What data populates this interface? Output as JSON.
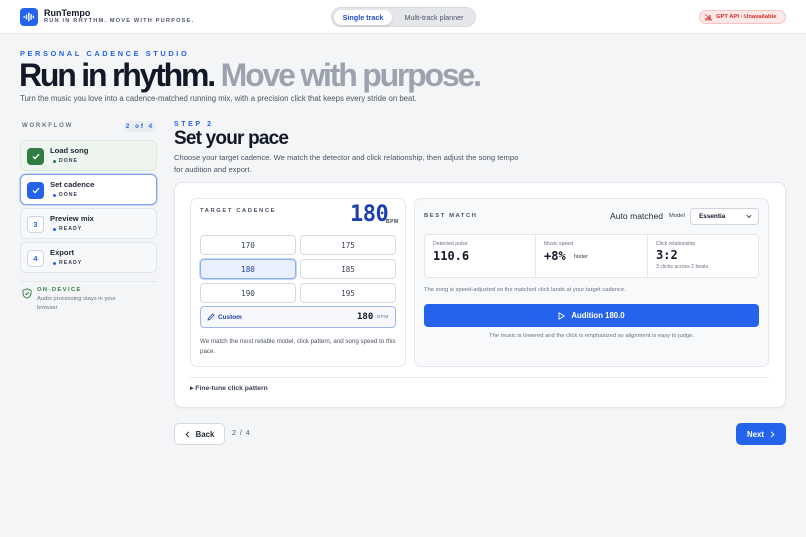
{
  "app": {
    "name": "RunTempo",
    "tagline": "RUN IN RHYTHM. MOVE WITH PURPOSE."
  },
  "modes": [
    {
      "label": "Single track",
      "active": true
    },
    {
      "label": "Multi-track planner",
      "active": false
    }
  ],
  "api_status": "GPT API · Unavailable",
  "hero": {
    "eyebrow": "PERSONAL CADENCE STUDIO",
    "title_dark": "Run in rhythm.",
    "title_muted": "Move with purpose.",
    "subtitle": "Turn the music you love into a cadence-matched running mix, with a precision click that keeps every stride on beat."
  },
  "workflow": {
    "title": "WORKFLOW",
    "count": "2 of 4",
    "steps": [
      {
        "label": "Load song",
        "status": "DONE",
        "icon": "check-icon",
        "num": ""
      },
      {
        "label": "Set cadence",
        "status": "DONE",
        "icon": "check-icon",
        "num": ""
      },
      {
        "label": "Preview mix",
        "status": "READY",
        "icon": "",
        "num": "3"
      },
      {
        "label": "Export",
        "status": "READY",
        "icon": "",
        "num": "4"
      }
    ],
    "on_device_title": "ON-DEVICE",
    "on_device_text": "Audio processing stays in your browser"
  },
  "step": {
    "eyebrow": "STEP 2",
    "title": "Set your pace",
    "description": "Choose your target cadence. We match the detector and click relationship, then adjust the song tempo for audition and export."
  },
  "target_cadence": {
    "label": "TARGET CADENCE",
    "value": "180",
    "unit": "BPM",
    "options": [
      "170",
      "175",
      "180",
      "185",
      "190",
      "195"
    ],
    "selected": "180",
    "custom_label": "Custom",
    "custom_value": "180",
    "custom_unit": "BPM",
    "note": "We match the most reliable model, click pattern, and song speed to this pace."
  },
  "best_match": {
    "label": "BEST MATCH",
    "auto_label": "Auto matched",
    "model_label": "Model",
    "model_value": "Essentia",
    "detected_caption": "Detected pulse",
    "detected_value": "110.6",
    "speed_caption": "Music speed",
    "speed_value": "+8%",
    "speed_suffix": "faster",
    "click_caption": "Click relationship",
    "click_value": "3:2",
    "click_sub": "3 clicks across 2 beats",
    "note": "The song is speed-adjusted so the matched click lands at your target cadence.",
    "audition_label": "Audition 180.0",
    "note2": "The music is lowered and the click is emphasized so alignment is easy to judge."
  },
  "finetune_label": "▸ Fine-tune click pattern",
  "nav": {
    "back": "Back",
    "pager": "2 / 4",
    "next": "Next"
  },
  "colors": {
    "accent": "#2563eb",
    "done_green": "#2f7d43",
    "error_red": "#dc2626"
  }
}
